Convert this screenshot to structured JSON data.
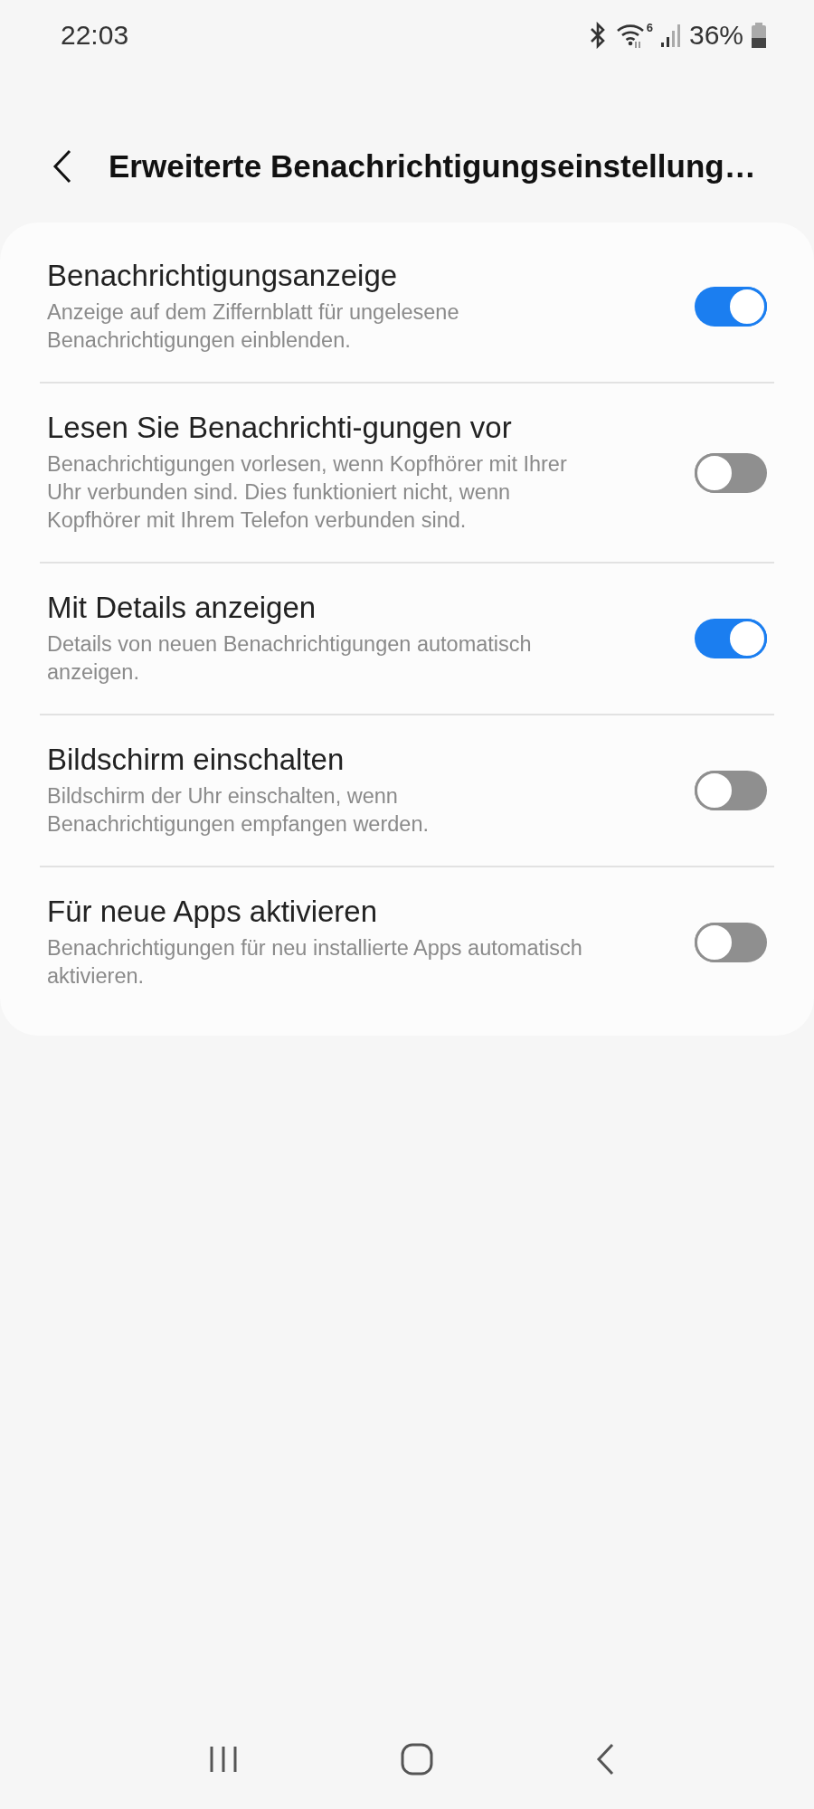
{
  "status_bar": {
    "time": "22:03",
    "wifi_badge": "6",
    "battery": "36%"
  },
  "header": {
    "title": "Erweiterte Benachrichtigungseinstellung…"
  },
  "settings": [
    {
      "title": "Benachrichtigungsanzeige",
      "description": "Anzeige auf dem Ziffernblatt für ungelesene Benachrichtigungen einblenden.",
      "on": true
    },
    {
      "title": "Lesen Sie Benachrichti-gungen vor",
      "description": "Benachrichtigungen vorlesen, wenn Kopfhörer mit Ihrer Uhr verbunden sind. Dies funktioniert nicht, wenn Kopfhörer mit Ihrem Telefon verbunden sind.",
      "on": false
    },
    {
      "title": "Mit Details anzeigen",
      "description": "Details von neuen Benachrichtigungen automatisch anzeigen.",
      "on": true
    },
    {
      "title": "Bildschirm einschalten",
      "description": "Bildschirm der Uhr einschalten, wenn Benachrichtigungen empfangen werden.",
      "on": false
    },
    {
      "title": "Für neue Apps aktivieren",
      "description": "Benachrichtigungen für neu installierte Apps automatisch aktivieren.",
      "on": false
    }
  ]
}
